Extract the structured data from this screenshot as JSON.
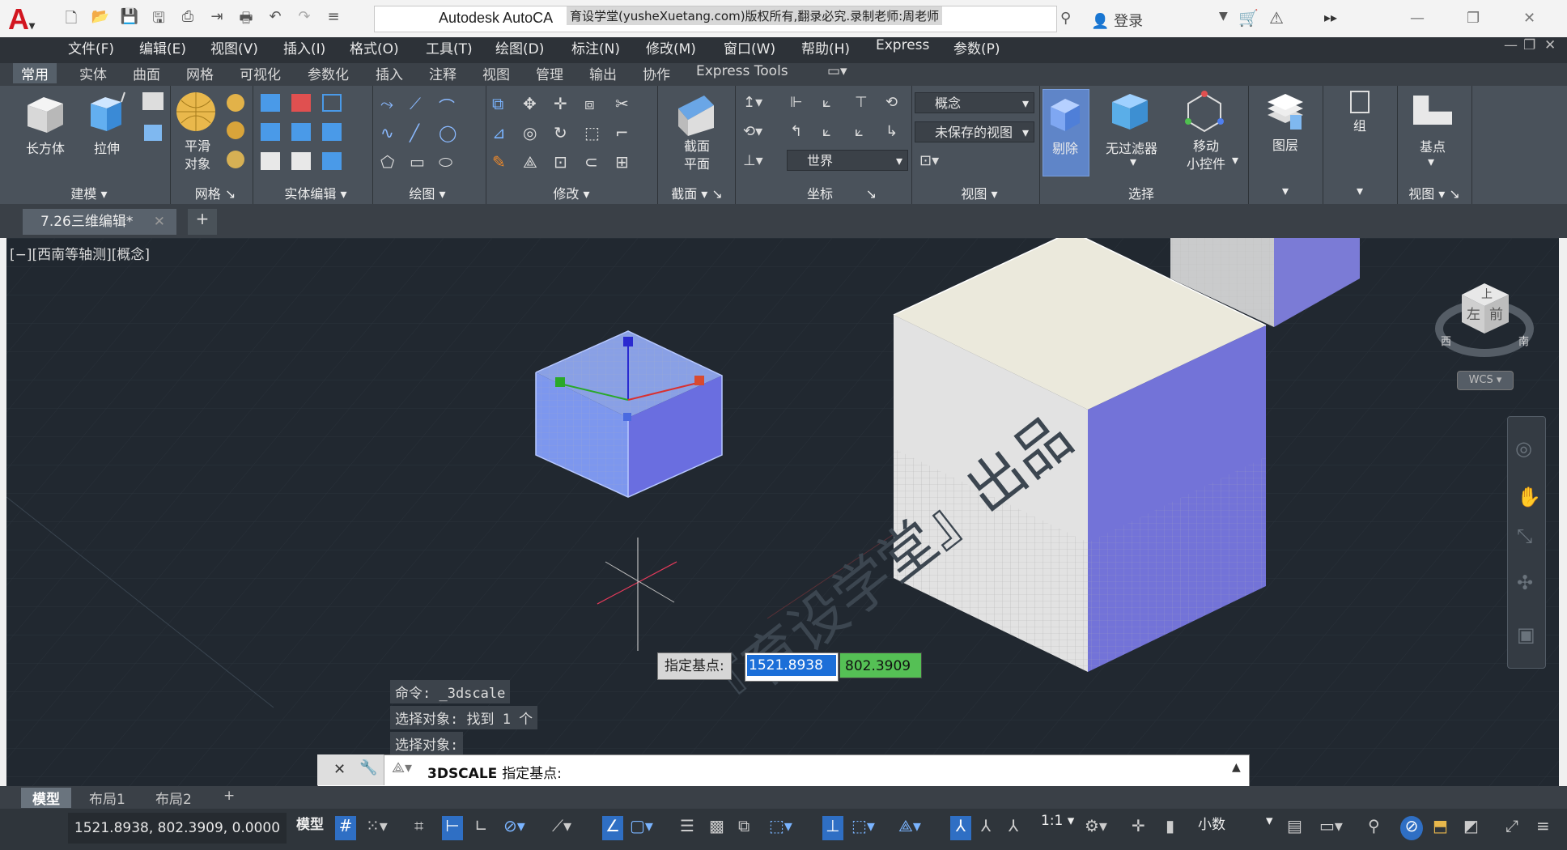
{
  "titlebar": {
    "app_title": "Autodesk AutoCA",
    "watermark": "育设学堂(yusheXuetang.com)版权所有,翻录必究.录制老师:周老师",
    "login": "登录",
    "qat_icons": [
      "new-icon",
      "open-icon",
      "save-icon",
      "saveas-icon",
      "publish-icon",
      "undo-icon",
      "redo-icon",
      "more-icon"
    ]
  },
  "menu": [
    "文件(F)",
    "编辑(E)",
    "视图(V)",
    "插入(I)",
    "格式(O)",
    "工具(T)",
    "绘图(D)",
    "标注(N)",
    "修改(M)",
    "窗口(W)",
    "帮助(H)",
    "Express",
    "参数(P)"
  ],
  "ribbon_tabs": [
    "常用",
    "实体",
    "曲面",
    "网格",
    "可视化",
    "参数化",
    "插入",
    "注释",
    "视图",
    "管理",
    "输出",
    "协作",
    "Express Tools"
  ],
  "ribbon": {
    "box": "长方体",
    "extrude": "拉伸",
    "smooth_1": "平滑",
    "smooth_2": "对象",
    "section_1": "截面",
    "section_2": "平面",
    "visual_style": "概念",
    "saved_view": "未保存的视图",
    "ucs_world": "世界",
    "cull": "剔除",
    "no_filter": "无过滤器",
    "gizmo_1": "移动",
    "gizmo_2": "小控件",
    "layers": "图层",
    "group": "组",
    "base_point": "基点"
  },
  "panels": [
    "建模",
    "网格",
    "实体编辑",
    "绘图",
    "修改",
    "截面",
    "坐标",
    "视图",
    "选择",
    "视图"
  ],
  "document_tab": "7.26三维编辑*",
  "viewport": {
    "label": "[−][西南等轴测][概念]",
    "viewcube_top": "上",
    "viewcube_left": "左",
    "viewcube_front": "前",
    "compass_w": "西",
    "compass_s": "南",
    "wcs": "WCS",
    "watermark": "『育设学堂』出品"
  },
  "dynamic_input": {
    "prompt": "指定基点:",
    "x": "1521.8938",
    "y": "802.3909"
  },
  "command_history": [
    "命令: _3dscale",
    "选择对象: 找到 1 个",
    "选择对象:"
  ],
  "command_line": {
    "command": "3DSCALE",
    "prompt": "指定基点:"
  },
  "layout_tabs": [
    "模型",
    "布局1",
    "布局2"
  ],
  "status": {
    "coords": "1521.8938, 802.3909, 0.0000",
    "model": "模型",
    "scale": "1:1",
    "units": "小数"
  },
  "colors": {
    "viewport_bg": "#212830",
    "ribbon_bg": "#4a525b",
    "selection_blue": "#6f8fe6",
    "cube_top": "#ebe9dc",
    "cube_side": "#7373d8"
  }
}
